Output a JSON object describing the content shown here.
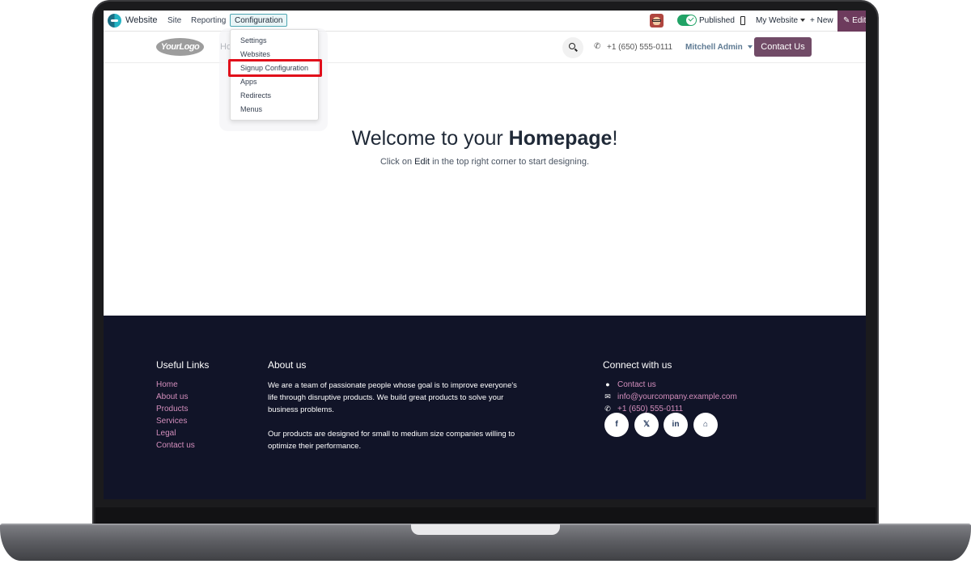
{
  "admin_bar": {
    "app_name": "Website",
    "menus": [
      "Site",
      "Reporting",
      "Configuration"
    ],
    "published_label": "Published",
    "website_selector": "My Website",
    "new_label": "+ New",
    "edit_label": "Edit"
  },
  "config_menu": {
    "items": [
      "Settings",
      "Websites",
      "Signup Configuration",
      "Apps",
      "Redirects",
      "Menus"
    ],
    "highlighted": "Signup Configuration"
  },
  "site_header": {
    "logo_text": "YourLogo",
    "nav_home": "Ho",
    "phone": "+1 (650) 555-0111",
    "user": "Mitchell Admin",
    "contact_button": "Contact Us"
  },
  "main": {
    "welcome_prefix": "Welcome to your ",
    "welcome_bold": "Homepage",
    "welcome_suffix": "!",
    "sub_prefix": "Click on ",
    "sub_bold": "Edit",
    "sub_suffix": " in the top right corner to start designing."
  },
  "footer": {
    "useful_links_heading": "Useful Links",
    "useful_links": [
      "Home",
      "About us",
      "Products",
      "Services",
      "Legal",
      "Contact us"
    ],
    "about_heading": "About us",
    "about_lines": [
      "We are a team of passionate people whose goal is to improve everyone's",
      "life through disruptive products. We build great products to solve your",
      "business problems.",
      "",
      "Our products are designed for small to medium size companies willing to",
      "optimize their performance."
    ],
    "connect_heading": "Connect with us",
    "contact_link": "Contact us",
    "email": "info@yourcompany.example.com",
    "phone": "+1 (650) 555-0111",
    "social": [
      "f",
      "𝕏",
      "in",
      "⌂"
    ]
  },
  "colors": {
    "brand": "#714b67",
    "toggle_on": "#21a366",
    "footer_bg": "#111428",
    "footer_link": "#d38ebc",
    "highlight_box": "#e10e1a"
  }
}
